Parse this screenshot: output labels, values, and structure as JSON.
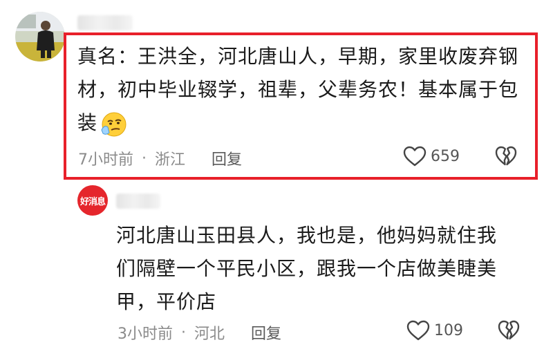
{
  "comments": [
    {
      "text_lines": [
        "真名：王洪全，河北唐山人，早期，家里收废弃钢",
        "材，初中毕业辍学，祖辈，父辈务农！基本属于包",
        "装"
      ],
      "emoji": "thinking-face-emoji",
      "time": "7小时前",
      "separator": "·",
      "location": "浙江",
      "reply_label": "回复",
      "likes": "659",
      "highlighted": true,
      "highlight_color": "#e8202a"
    },
    {
      "avatar_text": "好消息",
      "avatar_color": "#e5262c",
      "text_lines": [
        "河北唐山玉田县人，我也是，他妈妈就住我",
        "们隔壁一个平民小区，跟我一个店做美睫美",
        "甲，平价店"
      ],
      "time": "3小时前",
      "separator": "·",
      "location": "河北",
      "reply_label": "回复",
      "likes": "109"
    }
  ],
  "icons": {
    "like": "heart-outline-icon",
    "dislike": "broken-heart-icon"
  }
}
